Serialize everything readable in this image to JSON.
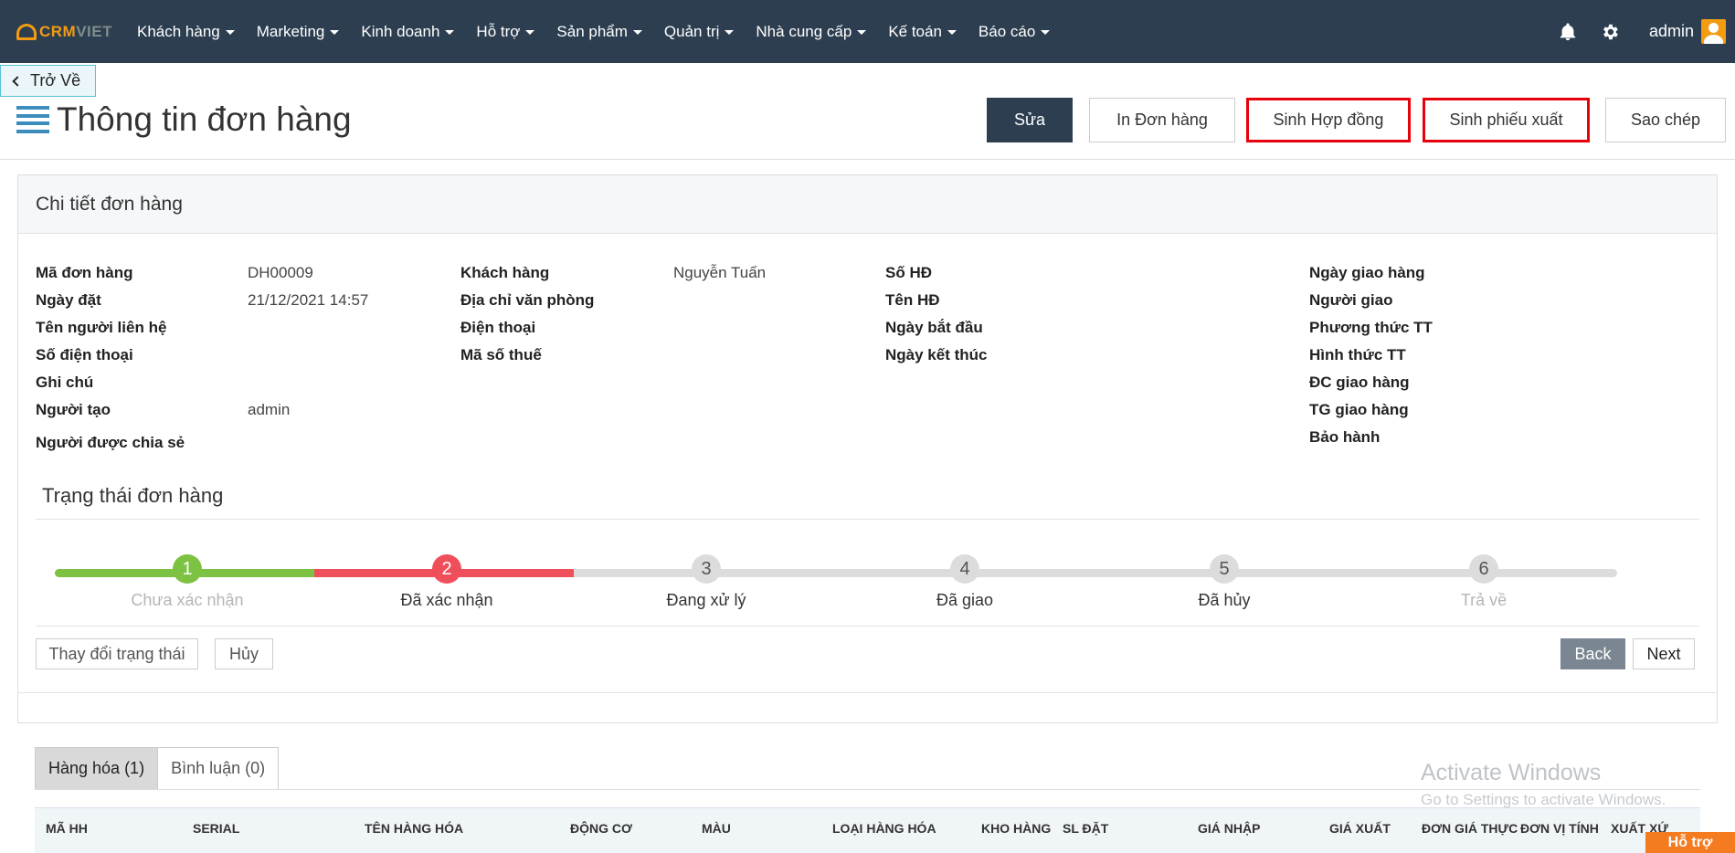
{
  "brand": {
    "part1": "CRM",
    "part2": "VIET"
  },
  "nav": {
    "items": [
      "Khách hàng",
      "Marketing",
      "Kinh doanh",
      "Hỗ trợ",
      "Sản phẩm",
      "Quản trị",
      "Nhà cung cấp",
      "Kế toán",
      "Báo cáo"
    ],
    "user": "admin"
  },
  "back_label": "Trở Về",
  "page_title": "Thông tin đơn hàng",
  "actions": {
    "edit": "Sửa",
    "print": "In Đơn hàng",
    "contract": "Sinh Hợp đồng",
    "export": "Sinh phiếu xuất",
    "copy": "Sao chép"
  },
  "card_title": "Chi tiết đơn hàng",
  "info": {
    "col1": [
      {
        "label": "Mã đơn hàng",
        "value": "DH00009"
      },
      {
        "label": "Ngày đặt",
        "value": "21/12/2021 14:57"
      },
      {
        "label": "Tên người liên hệ",
        "value": ""
      },
      {
        "label": "Số điện thoại",
        "value": ""
      },
      {
        "label": "Ghi chú",
        "value": ""
      },
      {
        "label": "Người tạo",
        "value": "admin"
      },
      {
        "label": "Người được chia sẻ",
        "value": ""
      }
    ],
    "col2": [
      {
        "label": "Khách hàng",
        "value": "Nguyễn Tuấn"
      },
      {
        "label": "Địa chỉ văn phòng",
        "value": ""
      },
      {
        "label": "Điện thoại",
        "value": ""
      },
      {
        "label": "Mã số thuế",
        "value": ""
      }
    ],
    "col3": [
      {
        "label": "Số HĐ",
        "value": ""
      },
      {
        "label": "Tên HĐ",
        "value": ""
      },
      {
        "label": "Ngày bắt đầu",
        "value": ""
      },
      {
        "label": "Ngày kết thúc",
        "value": ""
      }
    ],
    "col4": [
      {
        "label": "Ngày giao hàng",
        "value": ""
      },
      {
        "label": "Người giao",
        "value": ""
      },
      {
        "label": "Phương thức TT",
        "value": ""
      },
      {
        "label": "Hình thức TT",
        "value": ""
      },
      {
        "label": "ĐC giao hàng",
        "value": ""
      },
      {
        "label": "TG giao hàng",
        "value": ""
      },
      {
        "label": "Bảo hành",
        "value": ""
      }
    ]
  },
  "status": {
    "title": "Trạng thái đơn hàng",
    "steps": [
      {
        "num": "1",
        "label": "Chưa xác nhận",
        "state": "done"
      },
      {
        "num": "2",
        "label": "Đã xác nhận",
        "state": "current"
      },
      {
        "num": "3",
        "label": "Đang xử lý",
        "state": "pending"
      },
      {
        "num": "4",
        "label": "Đã giao",
        "state": "pending"
      },
      {
        "num": "5",
        "label": "Đã hủy",
        "state": "pending"
      },
      {
        "num": "6",
        "label": "Trả về",
        "state": "disabled"
      }
    ],
    "change_btn": "Thay đổi trạng thái",
    "cancel_btn": "Hủy",
    "back_btn": "Back",
    "next_btn": "Next"
  },
  "tabs": [
    {
      "label": "Hàng hóa (1)",
      "active": true
    },
    {
      "label": "Bình luận (0)",
      "active": false
    }
  ],
  "table_columns": [
    "MÃ HH",
    "SERIAL",
    "TÊN HÀNG HÓA",
    "ĐỘNG CƠ",
    "MÀU",
    "LOẠI HÀNG HÓA",
    "KHO HÀNG",
    "SL ĐẶT",
    "GIÁ NHẬP",
    "GIÁ XUẤT",
    "ĐƠN GIÁ THỰC",
    "ĐƠN VỊ TÍNH",
    "XUẤT XỨ"
  ],
  "watermark": {
    "title": "Activate Windows",
    "subtitle": "Go to Settings to activate Windows."
  },
  "support_label": "Hỗ trợ",
  "colors": {
    "nav_bg": "#2c3e50",
    "accent": "#f39c12",
    "done": "#7dc242",
    "current": "#ef4f5a",
    "highlight": "#e8000b"
  }
}
